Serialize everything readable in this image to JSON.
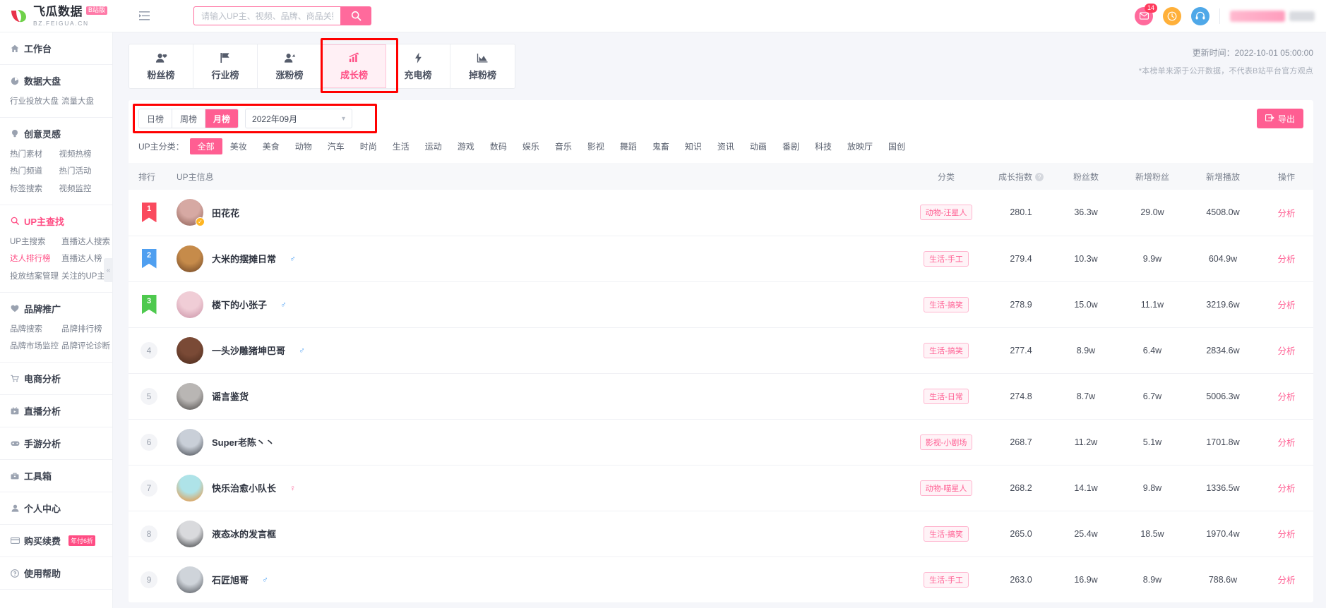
{
  "brand": {
    "name": "飞瓜数据",
    "badge": "B站版",
    "domain": "BZ.FEIGUA.CN"
  },
  "search": {
    "placeholder": "请输入UP主、视频、品牌、商品关键词搜索",
    "value": "",
    "button_icon": "search-icon"
  },
  "topbar": {
    "mail_badge": "14",
    "mail_icon": "mail-icon",
    "clock_icon": "clock-icon",
    "service_icon": "headset-icon",
    "collapse_icon": "menu-collapse-icon"
  },
  "sidebar": {
    "groups": [
      {
        "icon": "home-icon",
        "title": "工作台",
        "active": false,
        "items": []
      },
      {
        "icon": "dashboard-icon",
        "title": "数据大盘",
        "active": false,
        "items": [
          "行业投放大盘",
          "流量大盘"
        ]
      },
      {
        "icon": "bulb-icon",
        "title": "创意灵感",
        "active": false,
        "items": [
          "热门素材",
          "视频热榜",
          "热门频道",
          "热门活动",
          "标签搜索",
          "视频监控"
        ]
      },
      {
        "icon": "search-icon",
        "title": "UP主查找",
        "active": true,
        "items": [
          "UP主搜索",
          "直播达人搜索",
          "达人排行榜",
          "直播达人榜",
          "投放结案管理",
          "关注的UP主"
        ],
        "active_item": "达人排行榜"
      },
      {
        "icon": "heart-icon",
        "title": "品牌推广",
        "active": false,
        "items": [
          "品牌搜索",
          "品牌排行榜",
          "品牌市场监控",
          "品牌评论诊断"
        ]
      },
      {
        "icon": "cart-icon",
        "title": "电商分析",
        "active": false,
        "items": []
      },
      {
        "icon": "live-icon",
        "title": "直播分析",
        "active": false,
        "items": []
      },
      {
        "icon": "game-icon",
        "title": "手游分析",
        "active": false,
        "items": []
      },
      {
        "icon": "toolbox-icon",
        "title": "工具箱",
        "active": false,
        "items": []
      },
      {
        "icon": "user-icon",
        "title": "个人中心",
        "active": false,
        "items": []
      },
      {
        "icon": "card-icon",
        "title": "购买续费",
        "badge": "年付6折",
        "active": false,
        "items": []
      },
      {
        "icon": "help-icon",
        "title": "使用帮助",
        "active": false,
        "items": []
      }
    ]
  },
  "tabs": [
    {
      "label": "粉丝榜",
      "icon": "fans-icon",
      "selected": false
    },
    {
      "label": "行业榜",
      "icon": "flag-icon",
      "selected": false
    },
    {
      "label": "涨粉榜",
      "icon": "user-up-icon",
      "selected": false
    },
    {
      "label": "成长榜",
      "icon": "growth-chart-icon",
      "selected": true
    },
    {
      "label": "充电榜",
      "icon": "lightning-icon",
      "selected": false
    },
    {
      "label": "掉粉榜",
      "icon": "down-chart-icon",
      "selected": false
    }
  ],
  "update": {
    "time_label": "更新时间：2022-10-01 05:00:00",
    "note": "*本榜单来源于公开数据，不代表B站平台官方观点"
  },
  "filter": {
    "period_options": [
      {
        "label": "日榜",
        "on": false
      },
      {
        "label": "周榜",
        "on": false
      },
      {
        "label": "月榜",
        "on": true
      }
    ],
    "date_value": "2022年09月",
    "date_caret_icon": "chevron-down-icon",
    "export_label": "导出",
    "export_icon": "export-icon"
  },
  "categories": {
    "label": "UP主分类：",
    "items": [
      "全部",
      "美妆",
      "美食",
      "动物",
      "汽车",
      "时尚",
      "生活",
      "运动",
      "游戏",
      "数码",
      "娱乐",
      "音乐",
      "影视",
      "舞蹈",
      "鬼畜",
      "知识",
      "资讯",
      "动画",
      "番剧",
      "科技",
      "放映厅",
      "国创"
    ],
    "selected": "全部"
  },
  "table": {
    "columns": [
      {
        "key": "rank",
        "label": "排行"
      },
      {
        "key": "info",
        "label": "UP主信息"
      },
      {
        "key": "category",
        "label": "分类"
      },
      {
        "key": "growth_index",
        "label": "成长指数",
        "help": "?"
      },
      {
        "key": "fans",
        "label": "粉丝数"
      },
      {
        "key": "new_fans",
        "label": "新增粉丝"
      },
      {
        "key": "new_plays",
        "label": "新增播放"
      },
      {
        "key": "action",
        "label": "操作"
      }
    ],
    "action_label": "分析",
    "rows": [
      {
        "rank": "1",
        "medal": "gold",
        "name": "田花花",
        "gender": "",
        "verified": true,
        "avatar_c1": "#d6a9a3",
        "avatar_c2": "#8a5b50",
        "category": "动物-汪星人",
        "growth_index": "280.1",
        "fans": "36.3w",
        "new_fans": "29.0w",
        "new_plays": "4508.0w"
      },
      {
        "rank": "2",
        "medal": "silver",
        "name": "大米的摆摊日常",
        "gender": "male",
        "verified": false,
        "avatar_c1": "#c68b4a",
        "avatar_c2": "#6b4223",
        "category": "生活-手工",
        "growth_index": "279.4",
        "fans": "10.3w",
        "new_fans": "9.9w",
        "new_plays": "604.9w"
      },
      {
        "rank": "3",
        "medal": "bronze",
        "name": "楼下的小张子",
        "gender": "male",
        "verified": false,
        "avatar_c1": "#f0cdd6",
        "avatar_c2": "#c88fa4",
        "category": "生活-搞笑",
        "growth_index": "278.9",
        "fans": "15.0w",
        "new_fans": "11.1w",
        "new_plays": "3219.6w"
      },
      {
        "rank": "4",
        "medal": "",
        "name": "一头沙雕猪坤巴哥",
        "gender": "male",
        "verified": false,
        "avatar_c1": "#7a4a36",
        "avatar_c2": "#4a2a1c",
        "category": "生活-搞笑",
        "growth_index": "277.4",
        "fans": "8.9w",
        "new_fans": "6.4w",
        "new_plays": "2834.6w"
      },
      {
        "rank": "5",
        "medal": "",
        "name": "谣言鉴货",
        "gender": "",
        "verified": false,
        "avatar_c1": "#b9b6b4",
        "avatar_c2": "#4a4745",
        "category": "生活-日常",
        "growth_index": "274.8",
        "fans": "8.7w",
        "new_fans": "6.7w",
        "new_plays": "5006.3w"
      },
      {
        "rank": "6",
        "medal": "",
        "name": "Super老陈丶丶",
        "gender": "",
        "verified": false,
        "avatar_c1": "#c9cfd8",
        "avatar_c2": "#3a3e45",
        "category": "影视-小剧场",
        "growth_index": "268.7",
        "fans": "11.2w",
        "new_fans": "5.1w",
        "new_plays": "1701.8w"
      },
      {
        "rank": "7",
        "medal": "",
        "name": "快乐治愈小队长",
        "gender": "female",
        "verified": false,
        "avatar_c1": "#aee3e8",
        "avatar_c2": "#f08b2a",
        "category": "动物-喵星人",
        "growth_index": "268.2",
        "fans": "14.1w",
        "new_fans": "9.8w",
        "new_plays": "1336.5w"
      },
      {
        "rank": "8",
        "medal": "",
        "name": "液态冰的发言框",
        "gender": "",
        "verified": false,
        "avatar_c1": "#d9dadd",
        "avatar_c2": "#2e3033",
        "category": "生活-搞笑",
        "growth_index": "265.0",
        "fans": "25.4w",
        "new_fans": "18.5w",
        "new_plays": "1970.4w"
      },
      {
        "rank": "9",
        "medal": "",
        "name": "石匠旭哥",
        "gender": "male",
        "verified": false,
        "avatar_c1": "#cfd4da",
        "avatar_c2": "#474b52",
        "category": "生活-手工",
        "growth_index": "263.0",
        "fans": "16.9w",
        "new_fans": "8.9w",
        "new_plays": "788.6w"
      }
    ]
  }
}
